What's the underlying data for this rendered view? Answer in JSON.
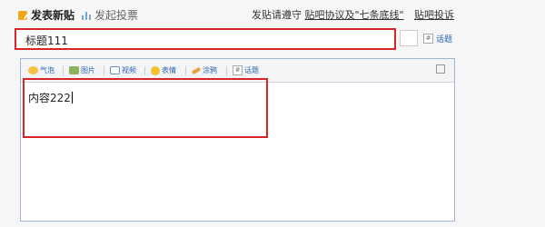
{
  "header": {
    "tab_new_post": "发表新贴",
    "tab_poll": "发起投票",
    "rules_prefix": "发贴请遵守",
    "rules_link": "贴吧协议及\"七条底线\"",
    "report_link": "贴吧投诉"
  },
  "title_input": {
    "value": "标题111"
  },
  "topic_mini_label": "话题",
  "toolbar": {
    "items": [
      "气泡",
      "图片",
      "视频",
      "表情",
      "涂鸦",
      "话题"
    ]
  },
  "content": {
    "value": "内容222"
  },
  "colors": {
    "highlight": "#d7262a",
    "link": "#2d64b3",
    "icon_orange": "#f0a41a"
  },
  "icons": [
    "edit-icon",
    "poll-icon",
    "hash-icon",
    "bubble-icon",
    "picture-icon",
    "video-icon",
    "emoji-icon",
    "brush-icon",
    "expand-icon"
  ]
}
